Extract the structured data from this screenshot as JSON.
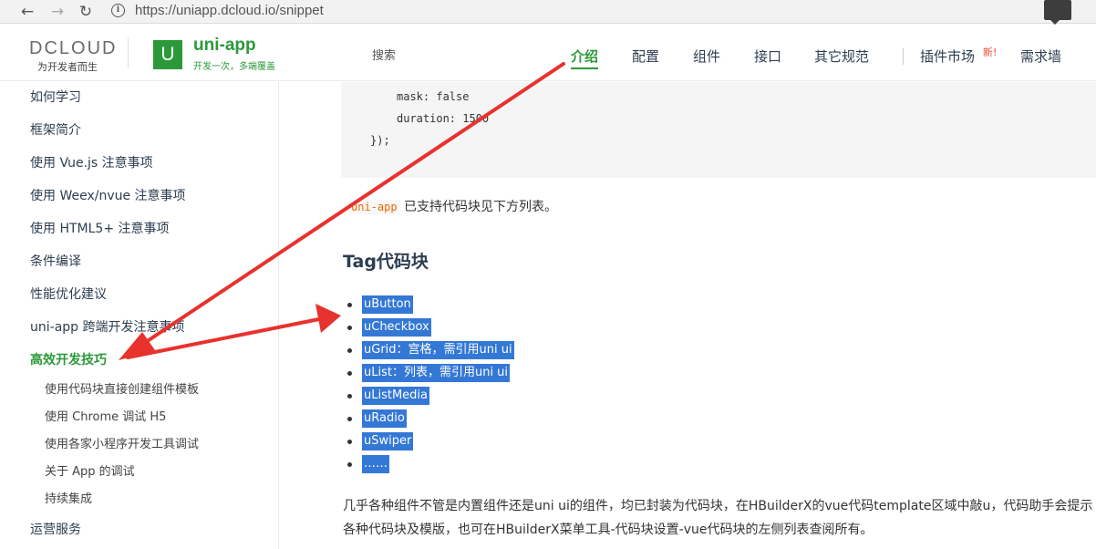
{
  "browser": {
    "back_glyph": "←",
    "forward_glyph": "→",
    "reload_glyph": "↻",
    "info_glyph": "i",
    "url": "https://uniapp.dcloud.io/snippet"
  },
  "header": {
    "dcloud_logo": "DCLOUD",
    "dcloud_slogan": "为开发者而生",
    "uni_logo_letter": "U",
    "uni_name": "uni-app",
    "uni_slogan": "开发一次，多端覆盖",
    "search_placeholder": "搜索",
    "nav": [
      "介绍",
      "配置",
      "组件",
      "接口",
      "其它规范",
      "插件市场",
      "需求墙"
    ],
    "new_badge": "新!",
    "brand_color": "#2b9939"
  },
  "sidebar": {
    "items": [
      "如何学习",
      "框架简介",
      "使用 Vue.js 注意事项",
      "使用 Weex/nvue 注意事项",
      "使用 HTML5+ 注意事项",
      "条件编译",
      "性能优化建议",
      "uni-app 跨端开发注意事项",
      "高效开发技巧"
    ],
    "sub_items": [
      "使用代码块直接创建组件模板",
      "使用 Chrome 调试 H5",
      "使用各家小程序开发工具调试",
      "关于 App 的调试",
      "持续集成"
    ],
    "footer_item": "运营服务"
  },
  "content": {
    "code_lines": [
      "mask: false",
      "duration: 1500",
      "});"
    ],
    "intro_code": "uni-app",
    "intro_text": " 已支持代码块见下方列表。",
    "section_title": "Tag代码块",
    "snippets": [
      "uButton",
      "uCheckbox",
      "uGrid：宫格，需引用uni ui",
      "uList：列表，需引用uni ui",
      "uListMedia",
      "uRadio",
      "uSwiper",
      "……"
    ],
    "paragraph": "几乎各种组件不管是内置组件还是uni ui的组件，均已封装为代码块，在HBuilderX的vue代码template区域中敲u，代码助手会提示各种代码块及模版，也可在HBuilderX菜单工具-代码块设置-vue代码块的左侧列表查阅所有。"
  },
  "annotation": {
    "arrow_color": "#e8322d"
  }
}
